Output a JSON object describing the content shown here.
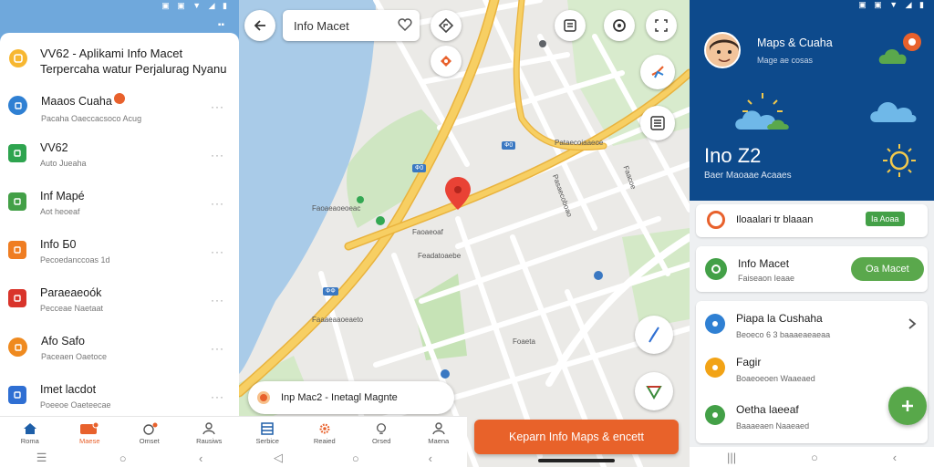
{
  "left": {
    "header_title": "VV62 - Aplikami Info Macet Terpercaha watur Perjalurag Nyanu",
    "items": [
      {
        "title": "Maaos Cuaha",
        "subtitle": "Pacaha Oaeccacsoco Acug",
        "color": "#2f80d3",
        "icon": "location-icon"
      },
      {
        "title": "VV62",
        "subtitle": "Auto Jueaha",
        "color": "#2ea44f",
        "icon": "app-icon"
      },
      {
        "title": "Inf Mapé",
        "subtitle": "Aot heoeaf",
        "color": "#43a047",
        "icon": "map-icon"
      },
      {
        "title": "Info Б0",
        "subtitle": "Pecoedanccoas 1d",
        "color": "#ef7d22",
        "icon": "info-icon"
      },
      {
        "title": "Paraeaeoók",
        "subtitle": "Pecceae Naetaat",
        "color": "#d9342b",
        "icon": "mail-icon"
      },
      {
        "title": "Afo Safo",
        "subtitle": "Paceaen Oaetoce",
        "color": "#ef8a1f",
        "icon": "safety-icon"
      },
      {
        "title": "Imet lacdot",
        "subtitle": "Poeeoe Oaeteecae",
        "color": "#2f6fd3",
        "icon": "book-icon"
      }
    ],
    "more": "···",
    "nav": [
      {
        "label": "Roma",
        "icon": "home-icon"
      },
      {
        "label": "Maese",
        "icon": "maps-icon"
      },
      {
        "label": "Omset",
        "icon": "alerts-icon"
      },
      {
        "label": "Rausiws",
        "icon": "profile-icon"
      }
    ]
  },
  "map": {
    "search_text": "Info Macet",
    "labels": [
      "Faoaeaoeoeac",
      "Faoaeoaf",
      "Feadatoaebe",
      "Faaaeaaoeaeto",
      "Pataecoiaaeoe",
      "Pasaecoboao",
      "Foaeta",
      "Faacoe"
    ],
    "shields": [
      "Ф0",
      "ФФ",
      "Ф0"
    ],
    "bottom_card_text": "Inp Mac2 - Inetagl Magnte",
    "nav": [
      {
        "label": "Serbice",
        "icon": "grid-icon"
      },
      {
        "label": "Reaied",
        "icon": "settings-icon"
      },
      {
        "label": "Orsed",
        "icon": "search-icon"
      },
      {
        "label": "Maena",
        "icon": "profile-icon"
      }
    ],
    "cta_label": "Keparn Info Maps & encett"
  },
  "right": {
    "profile_name": "Maps & Cuaha",
    "profile_sub": "Mage ae cosas",
    "weather_big": "Ino Z2",
    "weather_small": "Baer Maoaae Acaaes",
    "card1": {
      "text": "Iloaalari tr blaaan",
      "chip": "Ia Aoaa"
    },
    "card2": {
      "title": "Info Macet",
      "subtitle": "Faiseaon Ieaae",
      "button": "Oa Macet"
    },
    "list": [
      {
        "title": "Piapa la Cushaha",
        "subtitle": "Beoeco 6 3 baaaeaeaeaa",
        "color": "#2f80d3",
        "icon": "settings-icon"
      },
      {
        "title": "Fagir",
        "subtitle": "Boaeoeoen Waaeaed",
        "color": "#f2a316",
        "icon": "alert-icon"
      },
      {
        "title": "Oetha laeeaf",
        "subtitle": "Baaaeaen Naaeaed",
        "color": "#43a047",
        "icon": "location-icon"
      }
    ]
  }
}
